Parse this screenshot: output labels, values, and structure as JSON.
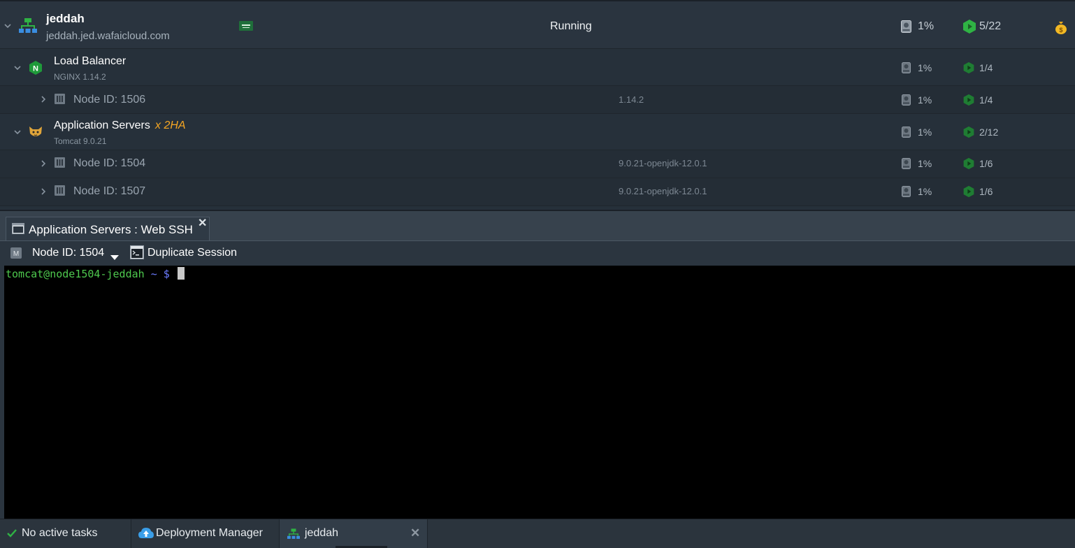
{
  "environment": {
    "name": "jeddah",
    "domain": "jeddah.jed.wafaicloud.com",
    "status": "Running",
    "disk": "1%",
    "cloudlets": "5/22"
  },
  "groups": [
    {
      "name": "Load Balancer",
      "sub": "NGINX 1.14.2",
      "disk": "1%",
      "cloudlets": "1/4",
      "ha": "",
      "nodes": [
        {
          "label": "Node ID: 1506",
          "version": "1.14.2",
          "disk": "1%",
          "cloudlets": "1/4"
        }
      ]
    },
    {
      "name": "Application Servers",
      "ha": "x 2HA",
      "sub": "Tomcat 9.0.21",
      "disk": "1%",
      "cloudlets": "2/12",
      "nodes": [
        {
          "label": "Node ID: 1504",
          "version": "9.0.21-openjdk-12.0.1",
          "disk": "1%",
          "cloudlets": "1/6"
        },
        {
          "label": "Node ID: 1507",
          "version": "9.0.21-openjdk-12.0.1",
          "disk": "1%",
          "cloudlets": "1/6"
        }
      ]
    }
  ],
  "ssh": {
    "tab_title": "Application Servers : Web SSH",
    "node_select": "Node ID: 1504",
    "node_badge": "M",
    "duplicate_label": "Duplicate Session",
    "prompt_user": "tomcat@node1504-jeddah",
    "prompt_rest": " ~ $"
  },
  "bottom": {
    "tasks": "No active tasks",
    "deployment_manager": "Deployment Manager",
    "env_tab": "jeddah"
  },
  "colors": {
    "accent_green": "#2fb344",
    "ha_orange": "#f5a623",
    "terminal_green": "#4ec94e",
    "terminal_blue": "#6c7cff"
  },
  "icons": {
    "env": "environment-topology-icon",
    "lb": "nginx-icon",
    "app": "tomcat-icon",
    "disk": "disk-icon",
    "cloudlet": "cloudlet-icon",
    "billing": "money-bag-icon"
  }
}
